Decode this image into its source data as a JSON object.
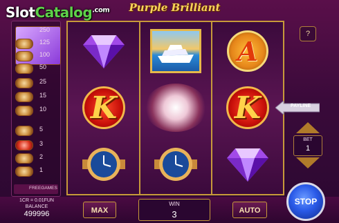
{
  "watermark": {
    "slot": "Slot",
    "catalog": "Catalog",
    "com": ".com"
  },
  "title": "Purple Brilliant",
  "paytable": {
    "values": [
      "250",
      "125",
      "100",
      "50",
      "25",
      "15",
      "10",
      "5",
      "3",
      "2",
      "1"
    ],
    "freegames_label": "FREEGAMES"
  },
  "reels": [
    [
      "gem-icon",
      "k-icon",
      "watch-icon"
    ],
    [
      "yacht-icon",
      "flare-icon",
      "watch-icon"
    ],
    [
      "a-icon",
      "k-icon",
      "gem-icon"
    ]
  ],
  "symbols": {
    "k": "K",
    "a": "A"
  },
  "right_panel": {
    "help_label": "?",
    "payline_label": "PAYLINE",
    "bet_label": "BET",
    "bet_value": "1"
  },
  "bottom": {
    "credit_info": "1CR = 0.01FUN",
    "balance_label": "BALANCE",
    "balance_value": "499996",
    "max_label": "MAX",
    "win_label": "WIN",
    "win_value": "3",
    "auto_label": "AUTO",
    "stop_label": "STOP"
  },
  "colors": {
    "accent": "#c89a3a",
    "background": "#3a0a3a",
    "stop_button": "#2a5ae8"
  }
}
